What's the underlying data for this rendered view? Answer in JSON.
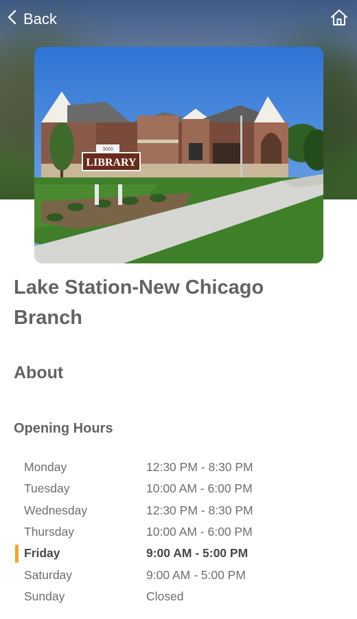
{
  "header": {
    "back_label": "Back",
    "back_icon": "chevron-left-icon",
    "home_icon": "home-icon"
  },
  "photo": {
    "sign_label": "LIBRARY",
    "sign_number": "3000"
  },
  "branch": {
    "title": "Lake Station-New Chicago Branch"
  },
  "about": {
    "heading": "About"
  },
  "opening_hours": {
    "heading": "Opening Hours",
    "highlight_color": "#f5a623",
    "days": [
      {
        "day": "Monday",
        "hours": "12:30 PM - 8:30 PM"
      },
      {
        "day": "Tuesday",
        "hours": "10:00 AM - 6:00 PM"
      },
      {
        "day": "Wednesday",
        "hours": "12:30 PM - 8:30 PM"
      },
      {
        "day": "Thursday",
        "hours": "10:00 AM - 6:00 PM"
      },
      {
        "day": "Friday",
        "hours": "9:00 AM - 5:00 PM",
        "today": true
      },
      {
        "day": "Saturday",
        "hours": "9:00 AM - 5:00 PM"
      },
      {
        "day": "Sunday",
        "hours": "Closed"
      }
    ]
  }
}
